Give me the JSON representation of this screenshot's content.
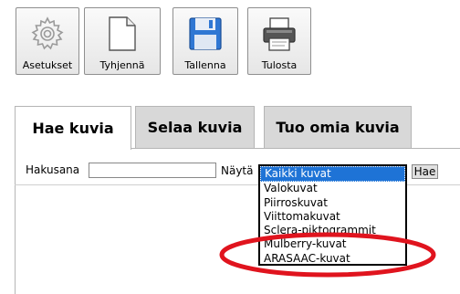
{
  "toolbar": {
    "settings_label": "Asetukset",
    "clear_label": "Tyhjennä",
    "save_label": "Tallenna",
    "print_label": "Tulosta"
  },
  "tabs": [
    {
      "label": "Hae kuvia",
      "active": true
    },
    {
      "label": "Selaa kuvia",
      "active": false
    },
    {
      "label": "Tuo omia kuvia",
      "active": false
    }
  ],
  "search": {
    "label": "Hakusana",
    "value": "",
    "show_label": "Näytä",
    "button_label": "Hae"
  },
  "dropdown": {
    "selected": "Kaikki kuvat",
    "options": [
      "Kaikki kuvat",
      "Valokuvat",
      "Piirroskuvat",
      "Viittomakuvat",
      "Sclera-piktogrammit",
      "Mulberry-kuvat",
      "ARASAAC-kuvat"
    ]
  },
  "colors": {
    "selection": "#1e73d6",
    "annotation": "#e0141e",
    "save_icon": "#2f77d3",
    "inactive_tab": "#d8d8d8"
  }
}
